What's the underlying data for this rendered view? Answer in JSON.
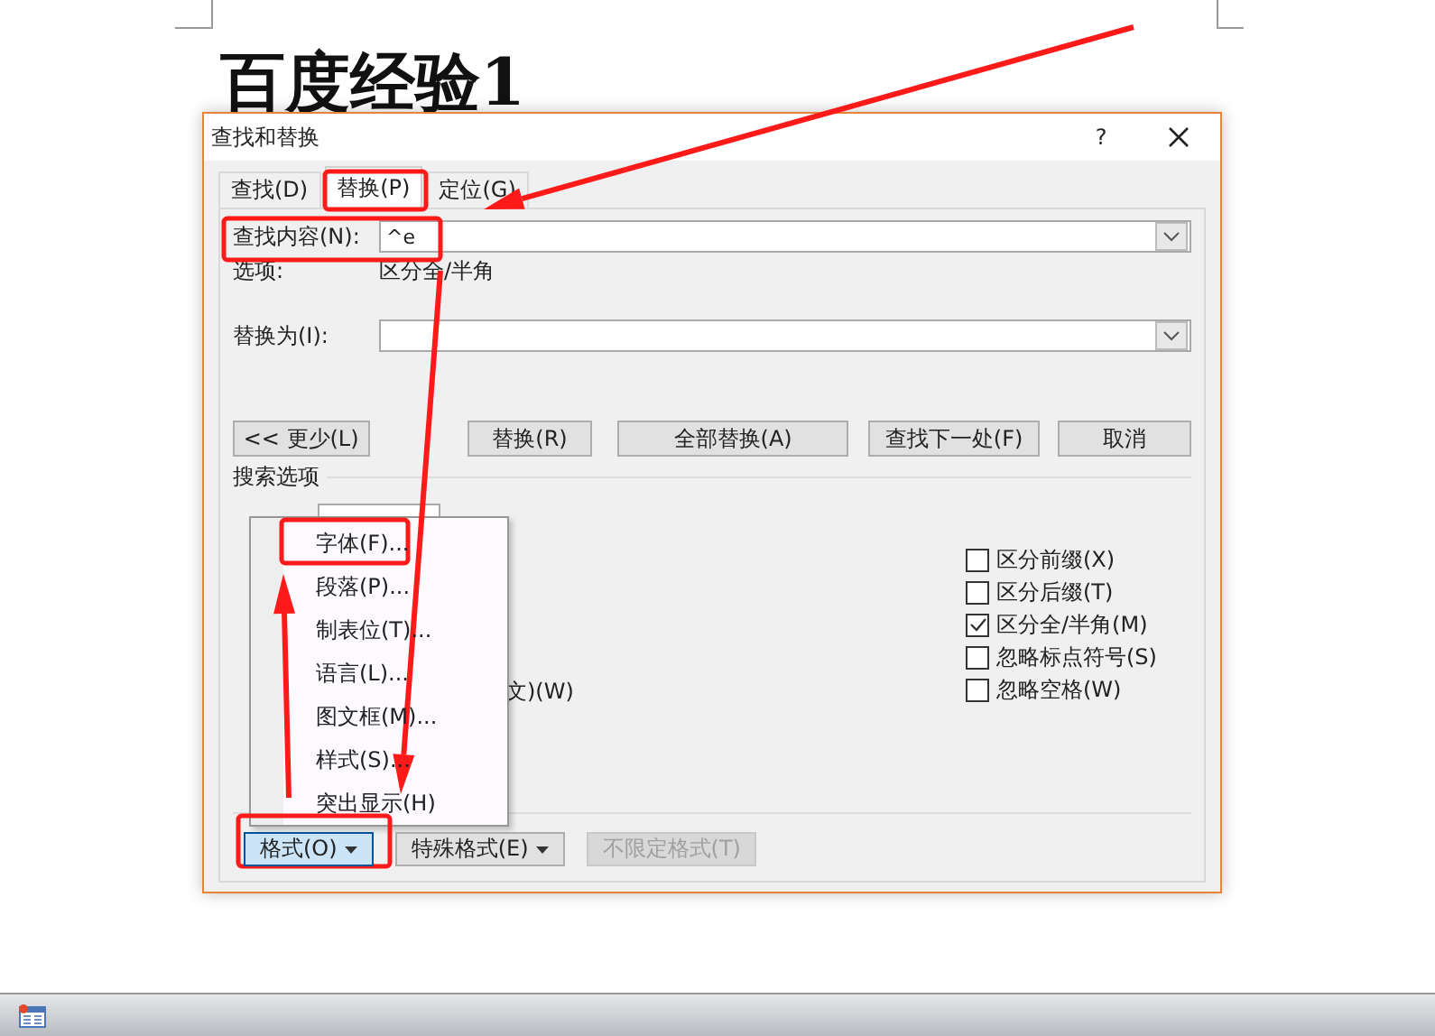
{
  "document": {
    "heading": "百度经验1"
  },
  "dialog": {
    "title": "查找和替换",
    "help": "?",
    "tabs": [
      {
        "label": "查找(D)",
        "selected": false
      },
      {
        "label": "替换(P)",
        "selected": true
      },
      {
        "label": "定位(G)",
        "selected": false
      }
    ],
    "find": {
      "label": "查找内容(N):",
      "value": "^e"
    },
    "options": {
      "label": "选项:",
      "value": "区分全/半角"
    },
    "replace": {
      "label": "替换为(I):"
    },
    "buttons": [
      "<< 更少(L)",
      "替换(R)",
      "全部替换(A)",
      "查找下一处(F)",
      "取消"
    ],
    "search_options": {
      "title": "搜索选项",
      "partial_text": "文)(W)",
      "checkboxes": [
        {
          "label": "区分前缀(X)",
          "checked": false
        },
        {
          "label": "区分后缀(T)",
          "checked": false
        },
        {
          "label": "区分全/半角(M)",
          "checked": true
        },
        {
          "label": "忽略标点符号(S)",
          "checked": false
        },
        {
          "label": "忽略空格(W)",
          "checked": false
        }
      ]
    },
    "replace_section": {
      "buttons": [
        {
          "label": "格式(O)",
          "kind": "menu",
          "pressed": true,
          "disabled": false
        },
        {
          "label": "特殊格式(E)",
          "kind": "menu",
          "pressed": false,
          "disabled": false
        },
        {
          "label": "不限定格式(T)",
          "kind": "plain",
          "pressed": false,
          "disabled": true
        }
      ]
    },
    "format_menu": [
      "字体(F)...",
      "段落(P)...",
      "制表位(T)...",
      "语言(L)...",
      "图文框(M)...",
      "样式(S)...",
      "突出显示(H)"
    ]
  }
}
